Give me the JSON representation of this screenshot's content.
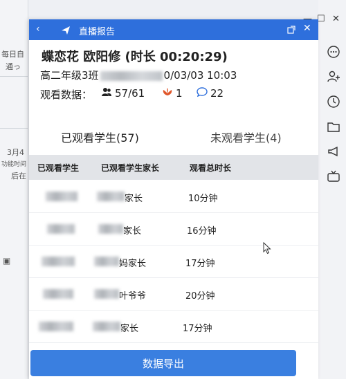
{
  "background_left": {
    "snippets": [
      "每日自",
      "通っ",
      "3月4",
      "功能时间",
      "后在"
    ]
  },
  "panel": {
    "window_title": "直播报告",
    "course_title": "蝶恋花 欧阳修 (时长 00:20:29)",
    "class_prefix": "高二年级3班",
    "class_suffix": "0/03/03 10:03",
    "stats": {
      "label": "观看数据：",
      "viewers": "57/61",
      "likes": "1",
      "comments": "22"
    },
    "tabs": [
      {
        "label": "已观看学生(57)",
        "active": true
      },
      {
        "label": "未观看学生(4)",
        "active": false
      }
    ],
    "table": {
      "headers": [
        "已观看学生",
        "已观看学生家长",
        "观看总时长"
      ],
      "rows": [
        {
          "parent_suffix": "家长",
          "duration": "10分钟"
        },
        {
          "parent_suffix": "家长",
          "duration": "16分钟"
        },
        {
          "parent_suffix": "妈家长",
          "duration": "17分钟"
        },
        {
          "parent_suffix": "叶爷爷",
          "duration": "20分钟"
        },
        {
          "parent_suffix": "家长",
          "duration": "17分钟"
        }
      ]
    },
    "export_label": "数据导出"
  },
  "colors": {
    "accent": "#2e6fdc",
    "button": "#3a7fe0",
    "header_bg": "#e2e4e8"
  },
  "icons": [
    "back-icon",
    "send-icon",
    "popout-icon",
    "close-icon",
    "viewers-icon",
    "flower-icon",
    "comment-icon",
    "more-icon",
    "add-person-icon",
    "clock-icon",
    "folder-icon",
    "megaphone-icon",
    "tv-icon"
  ]
}
